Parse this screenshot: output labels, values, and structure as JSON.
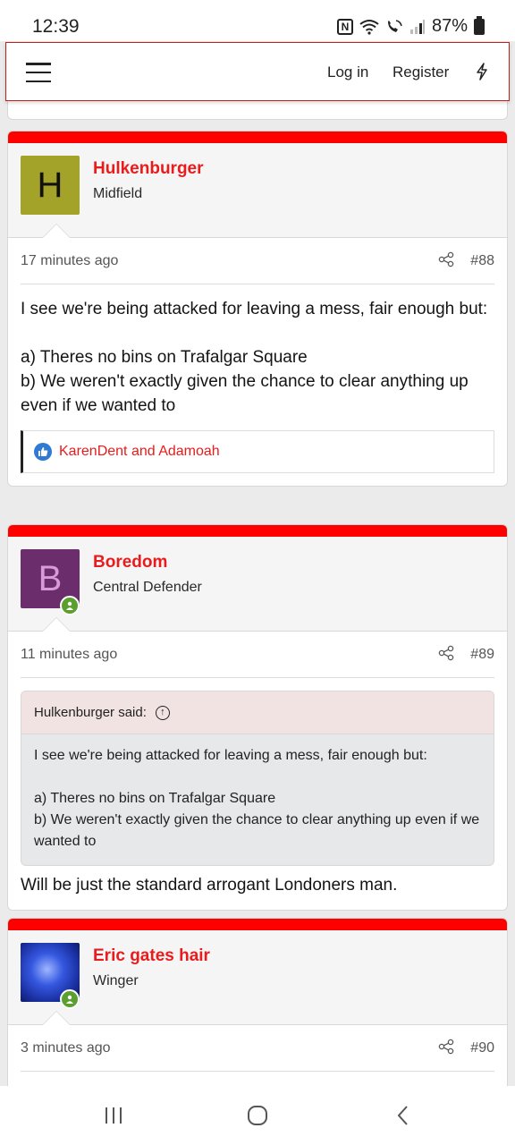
{
  "status_bar": {
    "time": "12:39",
    "battery": "87%",
    "nfc": "N"
  },
  "nav": {
    "login": "Log in",
    "register": "Register"
  },
  "posts": [
    {
      "author": "Hulkenburger",
      "role": "Midfield",
      "avatar_letter": "H",
      "avatar_color": "#a3a32a",
      "time": "17 minutes ago",
      "number": "#88",
      "body": [
        "I see we're being attacked for leaving a mess, fair enough but:",
        "a) Theres no bins on Trafalgar Square\nb) We weren't exactly given the chance to clear anything up even if we wanted to"
      ],
      "reactions": "KarenDent and Adamoah"
    },
    {
      "author": "Boredom",
      "role": "Central Defender",
      "avatar_letter": "B",
      "avatar_color": "#6b2d6b",
      "time": "11 minutes ago",
      "number": "#89",
      "quote_author": "Hulkenburger said:",
      "quote_body": [
        "I see we're being attacked for leaving a mess, fair enough but:",
        "a) Theres no bins on Trafalgar Square\nb) We weren't exactly given the chance to clear anything up even if we wanted to"
      ],
      "reply": "Will be just the standard arrogant Londoners man."
    },
    {
      "author": "Eric gates hair",
      "role": "Winger",
      "avatar_color": "#1e3fbf",
      "time": "3 minutes ago",
      "number": "#90"
    }
  ],
  "colors": {
    "accent": "#ff0000",
    "username": "#e81c1c",
    "online": "#5ba02f",
    "like": "#2f7bd3"
  },
  "icons": [
    "hamburger-icon",
    "bolt-icon",
    "share-icon",
    "like-icon",
    "arrow-up-circle-icon",
    "online-icon"
  ]
}
